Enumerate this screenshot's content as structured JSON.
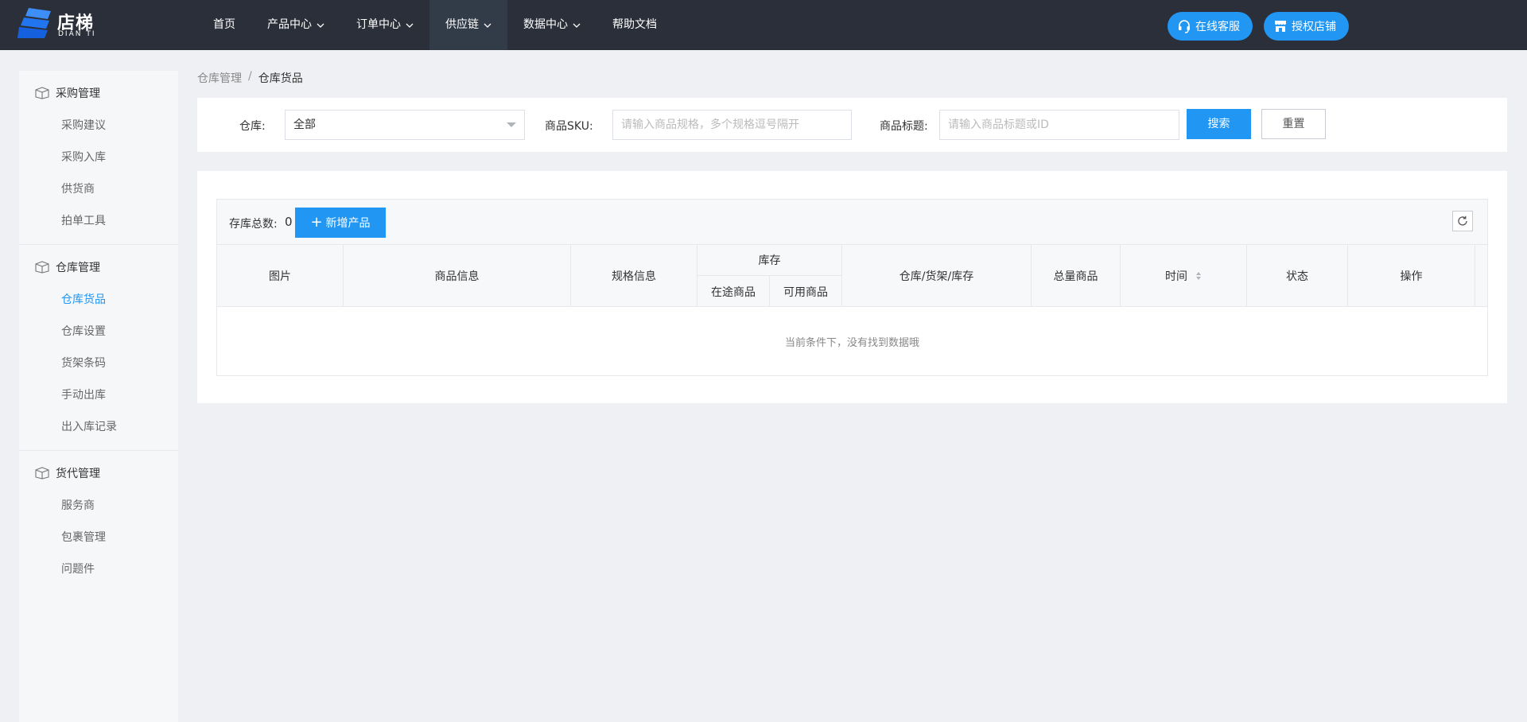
{
  "brand": {
    "name": "店梯",
    "sub": "DIAN TI",
    "accent": "#2196f3"
  },
  "nav": [
    {
      "label": "首页",
      "dropdown": false
    },
    {
      "label": "产品中心",
      "dropdown": true
    },
    {
      "label": "订单中心",
      "dropdown": true
    },
    {
      "label": "供应链",
      "dropdown": true,
      "active": true
    },
    {
      "label": "数据中心",
      "dropdown": true
    },
    {
      "label": "帮助文档",
      "dropdown": false
    }
  ],
  "header_actions": {
    "support": "在线客服",
    "authorize": "授权店铺"
  },
  "sidebar": {
    "groups": [
      {
        "title": "采购管理",
        "items": [
          "采购建议",
          "采购入库",
          "供货商",
          "拍单工具"
        ]
      },
      {
        "title": "仓库管理",
        "items": [
          "仓库货品",
          "仓库设置",
          "货架条码",
          "手动出库",
          "出入库记录"
        ],
        "active_item": "仓库货品"
      },
      {
        "title": "货代管理",
        "items": [
          "服务商",
          "包裹管理",
          "问题件"
        ]
      }
    ]
  },
  "breadcrumb": {
    "parent": "仓库管理",
    "separator": "/",
    "current": "仓库货品"
  },
  "filters": {
    "warehouse": {
      "label": "仓库:",
      "value": "全部"
    },
    "sku": {
      "label": "商品SKU:",
      "placeholder": "请输入商品规格，多个规格逗号隔开"
    },
    "title": {
      "label": "商品标题:",
      "placeholder": "请输入商品标题或ID"
    },
    "search_button": "搜索",
    "reset_button": "重置"
  },
  "toolbar": {
    "total_label": "存库总数:",
    "total_value": "0",
    "add_button": "新增产品"
  },
  "table": {
    "columns": {
      "image": "图片",
      "product_info": "商品信息",
      "spec_info": "规格信息",
      "stock": "库存",
      "stock_in_transit": "在途商品",
      "stock_available": "可用商品",
      "location": "仓库/货架/库存",
      "total": "总量商品",
      "time": "时间",
      "status": "状态",
      "actions": "操作"
    },
    "empty_text": "当前条件下，没有找到数据哦"
  }
}
